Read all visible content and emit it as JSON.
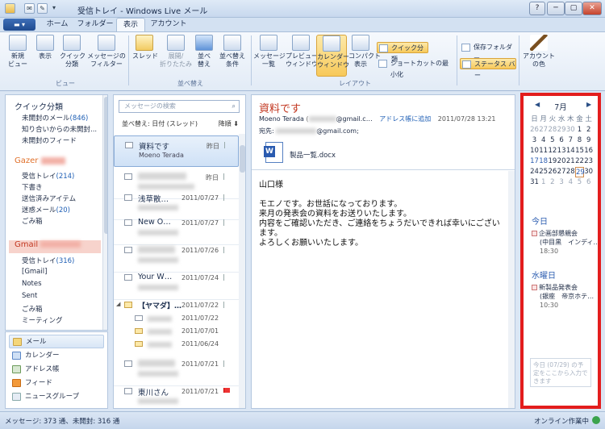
{
  "window": {
    "title": "受信トレイ - Windows Live メール"
  },
  "quick_access": [
    "✉",
    "✎",
    "▾"
  ],
  "window_buttons": [
    "?",
    "─",
    "▢",
    "✕"
  ],
  "tabs": [
    "ホーム",
    "フォルダー",
    "表示",
    "アカウント"
  ],
  "ribbon": {
    "view_group": {
      "label": "ビュー",
      "buttons": [
        "新規\nビュー",
        "表示",
        "クイック\n分類",
        "メッセージの\nフィルター"
      ]
    },
    "sort_group": {
      "label": "並べ替え",
      "buttons": [
        "スレッド",
        "展開/\n折りたたみ",
        "並べ\n替え",
        "並べ替え\n条件"
      ]
    },
    "layout_group": {
      "label": "レイアウト",
      "buttons": [
        "メッセージ\n一覧",
        "プレビュー\nウィンドウ",
        "カレンダー\nウィンドウ",
        "コンパクト\n表示"
      ]
    },
    "small_buttons": [
      "クイック分類",
      "ショートカットの最小化",
      "保存フォルダー",
      "ステータス バー"
    ],
    "account_color": "アカウント\nの色"
  },
  "folders": {
    "quick": {
      "title": "クイック分類",
      "items": [
        {
          "label": "未開封のメール",
          "count": "(846)"
        },
        {
          "label": "知り合いからの未開封...",
          "count": ""
        },
        {
          "label": "未開封のフィード",
          "count": ""
        }
      ]
    },
    "gazer": {
      "title": "Gazer",
      "items": [
        {
          "label": "受信トレイ",
          "count": "(214)"
        },
        {
          "label": "下書き",
          "count": ""
        },
        {
          "label": "送信済みアイテム",
          "count": ""
        },
        {
          "label": "迷惑メール",
          "count": "(20)"
        },
        {
          "label": "ごみ箱",
          "count": ""
        }
      ]
    },
    "gmail": {
      "title": "Gmail",
      "items": [
        {
          "label": "受信トレイ",
          "count": "(316)"
        },
        {
          "label": "[Gmail]",
          "count": ""
        },
        {
          "label": "Notes",
          "count": ""
        },
        {
          "label": "Sent",
          "count": ""
        },
        {
          "label": "ごみ箱",
          "count": ""
        },
        {
          "label": "ミーティング",
          "count": ""
        }
      ]
    }
  },
  "nav": [
    "メール",
    "カレンダー",
    "アドレス帳",
    "フィード",
    "ニュースグループ"
  ],
  "list": {
    "search_placeholder": "メッセージの検索",
    "sort_label": "並べ替え: 日付 (スレッド)",
    "sort_order": "降順 ⬇",
    "rows": [
      {
        "who": "資料です",
        "sub": "Moeno Terada",
        "date": "昨日"
      },
      {
        "who": "",
        "sub": "",
        "date": "昨日"
      },
      {
        "who": "浅草散…",
        "sub": "",
        "date": "2011/07/27"
      },
      {
        "who": "New O…",
        "sub": "",
        "date": "2011/07/27"
      },
      {
        "who": "",
        "sub": "",
        "date": "2011/07/26"
      },
      {
        "who": "Your W…",
        "sub": "",
        "date": "2011/07/24"
      }
    ],
    "thread": {
      "who": "【ヤマダ】…",
      "date": "2011/07/22",
      "children": [
        "2011/07/22",
        "2011/07/01",
        "2011/06/24"
      ]
    },
    "rows2": [
      {
        "who": "",
        "sub": "",
        "date": "2011/07/21"
      },
      {
        "who": "東川さん",
        "sub": "",
        "date": "2011/07/21"
      }
    ]
  },
  "message": {
    "subject": "資料です",
    "from_name": "Moeno Terada",
    "from_addr": "@gmail.c…",
    "add_contact": "アドレス帳に追加",
    "date": "2011/07/28 13:21",
    "to_label": "宛先:",
    "to_addr": "@gmail.com;",
    "attachment": "製品一覧.docx",
    "body": [
      "山口様",
      "",
      "モエノです。お世話になっております。",
      "来月の発表会の資料をお送りいたします。",
      "内容をご確認いただき、ご連絡をちょうだいできれば幸いにございます。",
      "よろしくお願いいたします。"
    ]
  },
  "calendar": {
    "month": "7月",
    "weekdays": [
      "日",
      "月",
      "火",
      "水",
      "木",
      "金",
      "土"
    ],
    "weeks": [
      [
        "26",
        "27",
        "28",
        "29",
        "30",
        "1",
        "2"
      ],
      [
        "3",
        "4",
        "5",
        "6",
        "7",
        "8",
        "9"
      ],
      [
        "10",
        "11",
        "12",
        "13",
        "14",
        "15",
        "16"
      ],
      [
        "17",
        "18",
        "19",
        "20",
        "21",
        "22",
        "23"
      ],
      [
        "24",
        "25",
        "26",
        "27",
        "28",
        "29",
        "30"
      ],
      [
        "31",
        "1",
        "2",
        "3",
        "4",
        "5",
        "6"
      ]
    ],
    "today_label": "今日",
    "today_event": {
      "title": "企画部懇親会",
      "place": "(中目黒　インディ…",
      "time": "18:30"
    },
    "wed_label": "水曜日",
    "wed_event": {
      "title": "新製品発表会",
      "place": "(銀座　帝京ホテ…",
      "time": "10:30"
    },
    "todo_placeholder": "今日 (07/29) の予定をここから入力できます"
  },
  "status": {
    "left": "メッセージ: 373 通、未開封: 316 通",
    "right": "オンライン作業中"
  }
}
